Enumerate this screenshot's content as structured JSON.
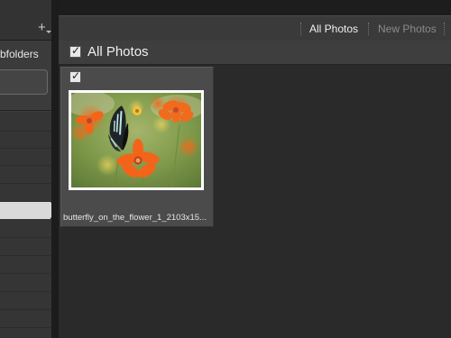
{
  "left_panel": {
    "add_icon": "plus-icon",
    "subfolders_label": "bfolders"
  },
  "filter_bar": {
    "tabs": [
      {
        "label": "All Photos",
        "active": true
      },
      {
        "label": "New Photos",
        "active": false
      }
    ]
  },
  "section": {
    "checked": true,
    "title": "All Photos"
  },
  "grid": {
    "items": [
      {
        "checked": true,
        "filename": "butterfly_on_the_flower_1_2103x15..."
      }
    ]
  },
  "colors": {
    "selected_row": "#d9d9d9",
    "active_tab": "#f0f0f0",
    "inactive_tab": "#8a8a8a"
  }
}
